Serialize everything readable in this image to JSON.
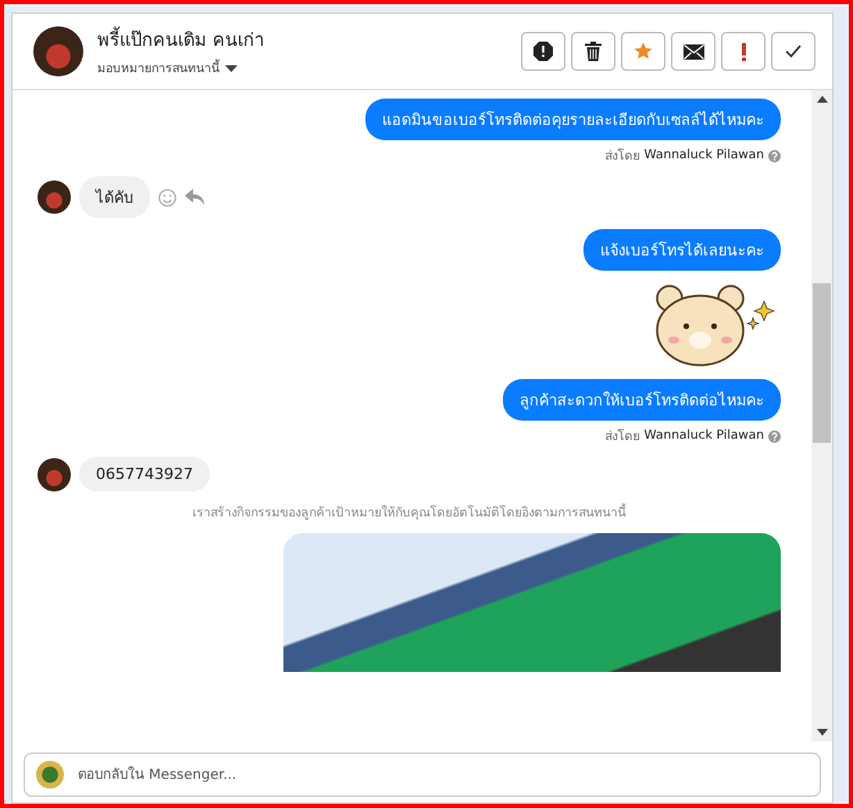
{
  "conversation": {
    "name": "พรี้แป๊กคนเดิม คนเก่า",
    "assign_label": "มอบหมายการสนทนานี้"
  },
  "messages": [
    {
      "kind": "outgoing",
      "text": "แอดมินขอเบอร์โทรติดต่อคุยรายละเอียดกับเซลล์ได้ไหมคะ",
      "sent_by_label": "ส่งโดย",
      "sent_by_name": "Wannaluck Pilawan"
    },
    {
      "kind": "incoming",
      "text": "ได้คับ",
      "show_actions": true
    },
    {
      "kind": "outgoing",
      "text": "แจ้งเบอร์โทรได้เลยนะคะ"
    },
    {
      "kind": "sticker"
    },
    {
      "kind": "outgoing",
      "text": "ลูกค้าสะดวกให้เบอร์โทรติดต่อไหมคะ",
      "sent_by_label": "ส่งโดย",
      "sent_by_name": "Wannaluck Pilawan"
    },
    {
      "kind": "incoming",
      "text": "0657743927",
      "show_actions": false
    },
    {
      "kind": "notice",
      "text": "เราสร้างกิจกรรมของลูกค้าเป้าหมายให้กับคุณโดยอัตโนมัติโดยอิงตามการสนทนานี้"
    },
    {
      "kind": "photo"
    }
  ],
  "reply": {
    "placeholder": "ตอบกลับใน Messenger..."
  }
}
